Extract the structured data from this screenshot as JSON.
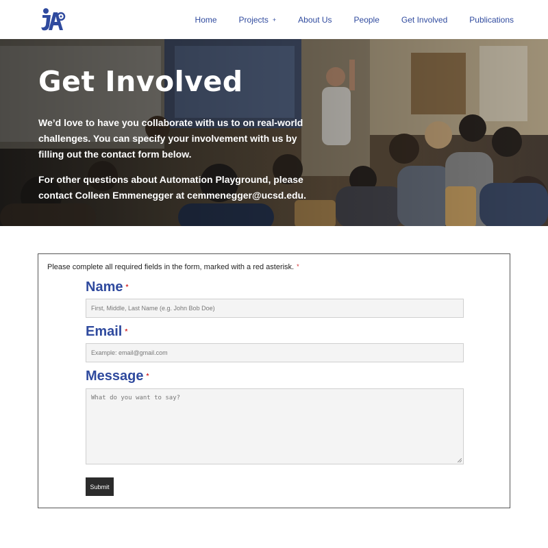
{
  "header": {
    "logo_name": "automation-playground-logo",
    "nav": [
      {
        "label": "Home"
      },
      {
        "label": "Projects",
        "has_dropdown": true,
        "caret": "+"
      },
      {
        "label": "About Us"
      },
      {
        "label": "People"
      },
      {
        "label": "Get Involved"
      },
      {
        "label": "Publications"
      }
    ]
  },
  "hero": {
    "title": "Get Involved",
    "paragraph1": "We’d love to have you collaborate with us to on real-world challenges. You can specify your involvement with us by filling out the contact form below.",
    "paragraph2": "For other questions about Automation Playground, please contact Colleen Emmenegger at cemmenegger@ucsd.edu."
  },
  "form": {
    "note": "Please complete all required fields in the form, marked with a red asterisk.",
    "required_marker": "*",
    "fields": {
      "name": {
        "label": "Name",
        "placeholder": "First, Middle, Last Name (e.g. John Bob Doe)"
      },
      "email": {
        "label": "Email",
        "placeholder": "Example: email@gmail.com"
      },
      "message": {
        "label": "Message",
        "placeholder": "What do you want to say?"
      }
    },
    "submit_label": "Submit"
  },
  "colors": {
    "brand_blue": "#2f4a9e",
    "required_red": "#d42a2a",
    "button_dark": "#2b2b2b"
  }
}
